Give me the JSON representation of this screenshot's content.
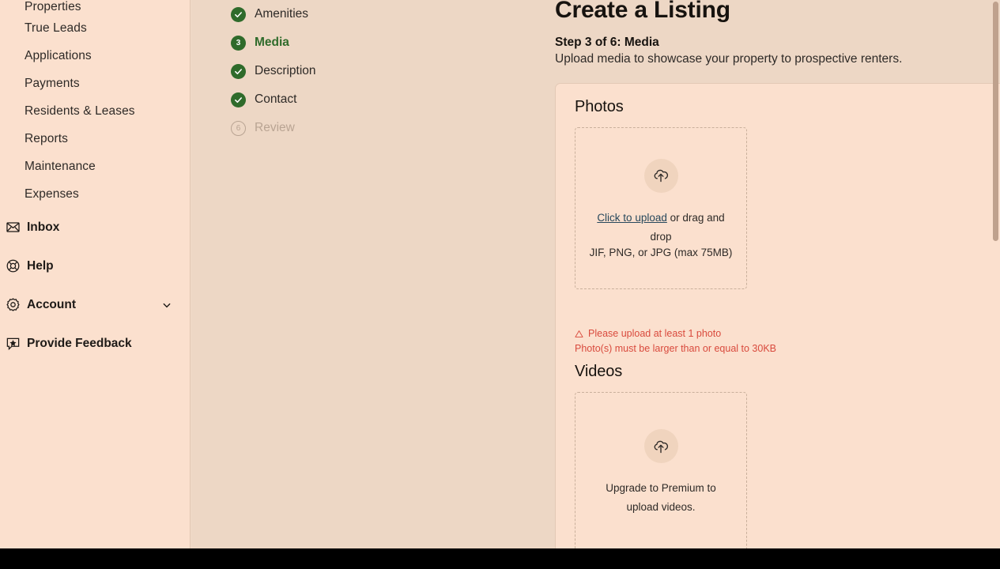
{
  "sidebar": {
    "items": [
      {
        "label": "Properties",
        "icon": "none",
        "type": "sub",
        "clipped": true
      },
      {
        "label": "True Leads",
        "icon": "none",
        "type": "sub"
      },
      {
        "label": "Applications",
        "icon": "none",
        "type": "sub"
      },
      {
        "label": "Payments",
        "icon": "none",
        "type": "sub"
      },
      {
        "label": "Residents & Leases",
        "icon": "none",
        "type": "sub"
      },
      {
        "label": "Reports",
        "icon": "none",
        "type": "sub"
      },
      {
        "label": "Maintenance",
        "icon": "none",
        "type": "sub"
      },
      {
        "label": "Expenses",
        "icon": "none",
        "type": "sub"
      },
      {
        "label": "Inbox",
        "icon": "envelope-icon",
        "type": "main"
      },
      {
        "label": "Help",
        "icon": "life-ring-icon",
        "type": "main"
      },
      {
        "label": "Account",
        "icon": "gear-icon",
        "type": "main",
        "chevron": "chevron-down-icon"
      },
      {
        "label": "Provide Feedback",
        "icon": "feedback-bubble-icon",
        "type": "main"
      }
    ]
  },
  "steps": {
    "items": [
      {
        "label": "Amenities",
        "state": "done",
        "marker": "check"
      },
      {
        "label": "Media",
        "state": "current",
        "marker": "3"
      },
      {
        "label": "Description",
        "state": "done",
        "marker": "check"
      },
      {
        "label": "Contact",
        "state": "done",
        "marker": "check"
      },
      {
        "label": "Review",
        "state": "todo",
        "marker": "6"
      }
    ]
  },
  "header": {
    "title": "Create a Listing",
    "step_label": "Step 3 of 6: Media",
    "step_description": "Upload media to showcase your property to prospective renters."
  },
  "photos": {
    "section_title": "Photos",
    "upload_link": "Click to upload",
    "upload_rest": " or drag and drop",
    "formats": "JIF, PNG, or JPG (max 75MB)",
    "upload_icon": "cloud-upload-icon"
  },
  "errors": {
    "warn_icon": "warning-triangle-icon",
    "message_1": "Please upload at least 1 photo",
    "message_2": "Photo(s) must be larger than or equal to 30KB"
  },
  "videos": {
    "section_title": "Videos",
    "upload_icon": "cloud-upload-icon",
    "message": "Upgrade to Premium to upload videos."
  },
  "colors": {
    "sidebar_bg": "#FBE0CE",
    "band_bg": "#EDD7C5",
    "card_bg": "#FBE0CE",
    "accent_green": "#2F6B2B",
    "link_blue": "#27485C",
    "error_red": "#D94A3D",
    "scrollbar": "#BFA18D"
  }
}
